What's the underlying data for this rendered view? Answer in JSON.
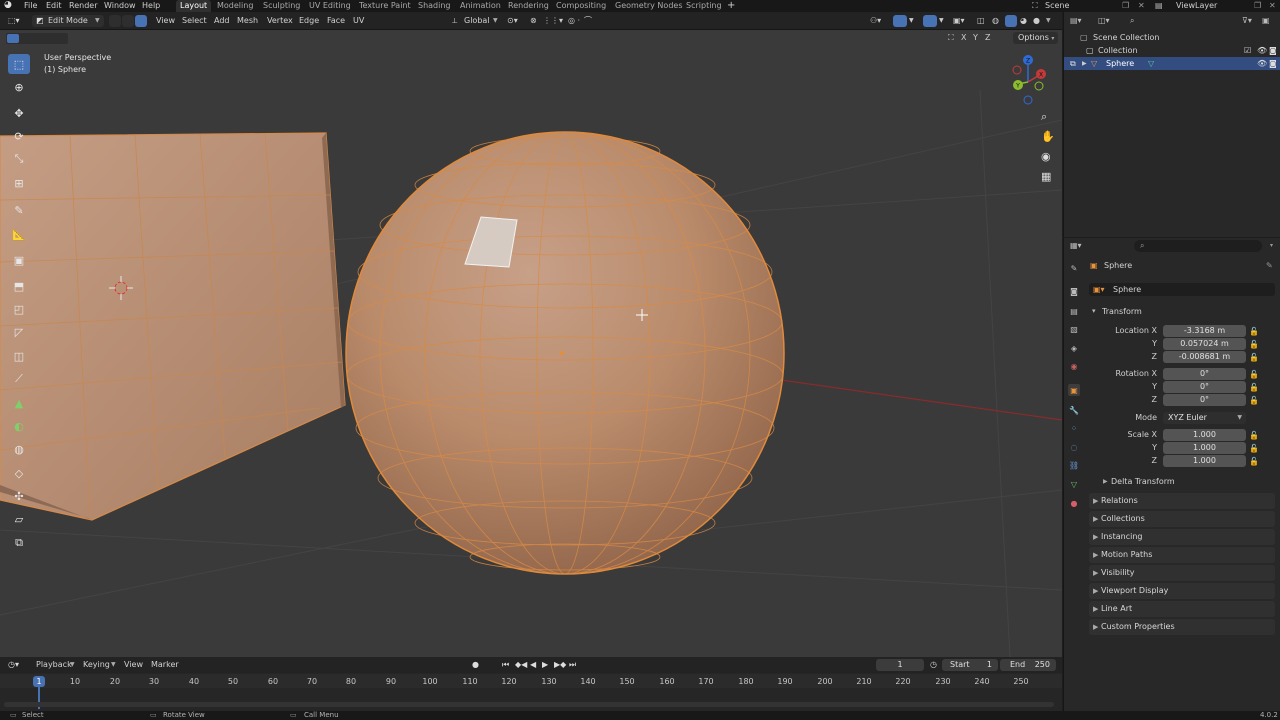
{
  "topbar": {
    "menus": [
      "File",
      "Edit",
      "Render",
      "Window",
      "Help"
    ],
    "workspaces": [
      "Layout",
      "Modeling",
      "Sculpting",
      "UV Editing",
      "Texture Paint",
      "Shading",
      "Animation",
      "Rendering",
      "Compositing",
      "Geometry Nodes",
      "Scripting"
    ],
    "active_workspace": "Layout",
    "add_tab": "+",
    "scene": "Scene",
    "view_layer": "ViewLayer"
  },
  "viewport_header": {
    "mode": "Edit Mode",
    "menus": [
      "View",
      "Select",
      "Add",
      "Mesh",
      "Vertex",
      "Edge",
      "Face",
      "UV"
    ],
    "orientation": "Global",
    "options": "Options",
    "axes": [
      "X",
      "Y",
      "Z"
    ]
  },
  "viewport": {
    "view_name": "User Perspective",
    "object_label": "(1) Sphere",
    "gizmo_axes": [
      "X",
      "Y",
      "Z"
    ]
  },
  "outliner": {
    "root": "Scene Collection",
    "collection": "Collection",
    "object": "Sphere"
  },
  "properties": {
    "object_name": "Sphere",
    "data_name": "Sphere",
    "transform_title": "Transform",
    "location_label": "Location X",
    "location": [
      "-3.3168 m",
      "0.057024 m",
      "-0.008681 m"
    ],
    "rotation_label": "Rotation X",
    "rotation": [
      "0°",
      "0°",
      "0°"
    ],
    "mode_label": "Mode",
    "mode_value": "XYZ Euler",
    "scale_label": "Scale X",
    "scale": [
      "1.000",
      "1.000",
      "1.000"
    ],
    "axis_y": "Y",
    "axis_z": "Z",
    "delta": "Delta Transform",
    "panels": [
      "Relations",
      "Collections",
      "Instancing",
      "Motion Paths",
      "Visibility",
      "Viewport Display",
      "Line Art",
      "Custom Properties"
    ]
  },
  "timeline": {
    "menus": [
      "Playback",
      "Keying",
      "View",
      "Marker"
    ],
    "current_frame": "1",
    "start_label": "Start",
    "start": "1",
    "end_label": "End",
    "end": "250",
    "ticks": [
      "1",
      "10",
      "20",
      "30",
      "40",
      "50",
      "60",
      "70",
      "80",
      "90",
      "100",
      "110",
      "120",
      "130",
      "140",
      "150",
      "160",
      "170",
      "180",
      "190",
      "200",
      "210",
      "220",
      "230",
      "240",
      "250"
    ]
  },
  "statusbar": {
    "select": "Select",
    "rotate": "Rotate View",
    "call_menu": "Call Menu",
    "version": "4.0.2"
  },
  "colors": {
    "accent": "#4772b3",
    "mesh_orange": "#e08a3a",
    "viewport_bg": "#3a3a3a",
    "panel_bg": "#282828"
  }
}
